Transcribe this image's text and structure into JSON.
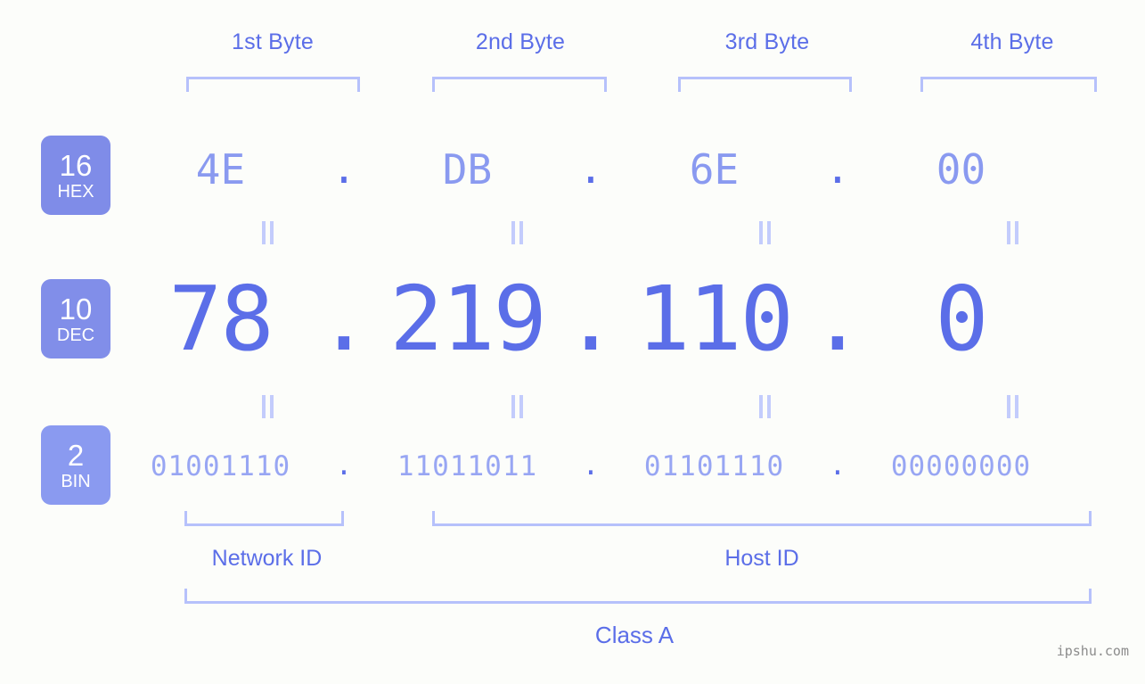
{
  "background_color": "#fcfdfa",
  "accent_color": "#5b6ee8",
  "accent_light": "#8a9af0",
  "bracket_color": "#b6c1fb",
  "byte_headers": [
    {
      "label": "1st Byte"
    },
    {
      "label": "2nd Byte"
    },
    {
      "label": "3rd Byte"
    },
    {
      "label": "4th Byte"
    }
  ],
  "bases": [
    {
      "number": "16",
      "abbr": "HEX",
      "color": "#7f8ce8"
    },
    {
      "number": "10",
      "abbr": "DEC",
      "color": "#818ee9"
    },
    {
      "number": "2",
      "abbr": "BIN",
      "color": "#8a9af0"
    }
  ],
  "separator": ".",
  "equals_symbol": "=",
  "rows": {
    "hex": {
      "values": [
        "4E",
        "DB",
        "6E",
        "00"
      ]
    },
    "dec": {
      "values": [
        "78",
        "219",
        "110",
        "0"
      ]
    },
    "bin": {
      "values": [
        "01001110",
        "11011011",
        "01101110",
        "00000000"
      ]
    }
  },
  "id_sections": [
    {
      "label": "Network ID"
    },
    {
      "label": "Host ID"
    }
  ],
  "class": {
    "label": "Class A"
  },
  "watermark": {
    "text": "ipshu.com"
  }
}
